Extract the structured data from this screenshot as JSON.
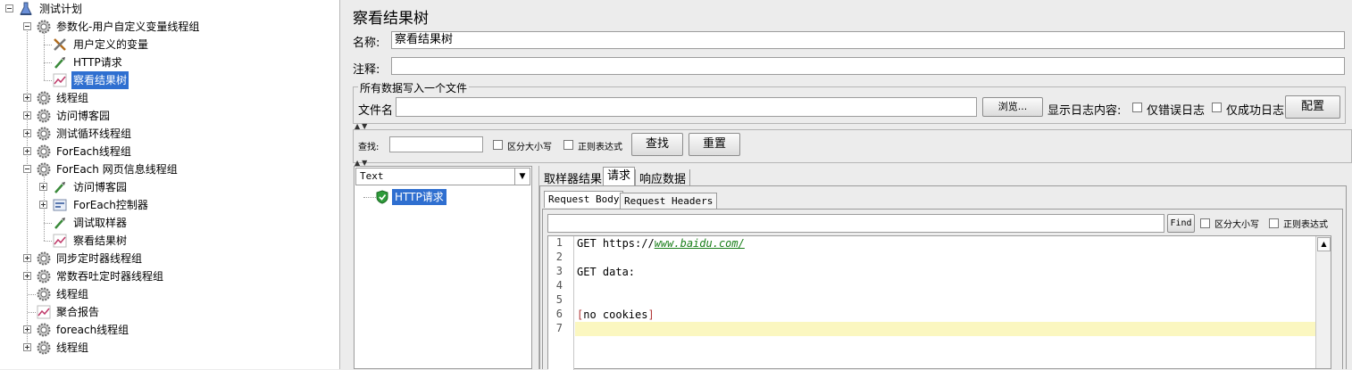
{
  "tree": {
    "items": [
      {
        "label": "测试计划",
        "icon": "test-plan-icon",
        "level": 0,
        "expander": "minus"
      },
      {
        "label": "参数化-用户自定义变量线程组",
        "icon": "thread-group-gear-icon",
        "level": 1,
        "expander": "minus"
      },
      {
        "label": "用户定义的变量",
        "icon": "config-tools-icon",
        "level": 2,
        "expander": ""
      },
      {
        "label": "HTTP请求",
        "icon": "sampler-pipette-icon",
        "level": 2,
        "expander": ""
      },
      {
        "label": "察看结果树",
        "icon": "listener-graph-icon",
        "level": 2,
        "expander": "",
        "selected": true
      },
      {
        "label": "线程组",
        "icon": "thread-group-gear-icon",
        "level": 1,
        "expander": "plus"
      },
      {
        "label": "访问博客园",
        "icon": "thread-group-gear-icon",
        "level": 1,
        "expander": "plus"
      },
      {
        "label": "测试循环线程组",
        "icon": "thread-group-gear-icon",
        "level": 1,
        "expander": "plus"
      },
      {
        "label": "ForEach线程组",
        "icon": "thread-group-gear-icon",
        "level": 1,
        "expander": "plus"
      },
      {
        "label": "ForEach 网页信息线程组",
        "icon": "thread-group-gear-icon",
        "level": 1,
        "expander": "minus"
      },
      {
        "label": "访问博客园",
        "icon": "sampler-pipette-icon",
        "level": 2,
        "expander": "plus"
      },
      {
        "label": "ForEach控制器",
        "icon": "controller-icon",
        "level": 2,
        "expander": "plus"
      },
      {
        "label": "调试取样器",
        "icon": "sampler-pipette-icon",
        "level": 2,
        "expander": ""
      },
      {
        "label": "察看结果树",
        "icon": "listener-graph-icon",
        "level": 2,
        "expander": ""
      },
      {
        "label": "同步定时器线程组",
        "icon": "thread-group-gear-icon",
        "level": 1,
        "expander": "plus"
      },
      {
        "label": "常数吞吐定时器线程组",
        "icon": "thread-group-gear-icon",
        "level": 1,
        "expander": "plus"
      },
      {
        "label": "线程组",
        "icon": "thread-group-gear-icon",
        "level": 1,
        "expander": ""
      },
      {
        "label": "聚合报告",
        "icon": "listener-graph-icon",
        "level": 1,
        "expander": ""
      },
      {
        "label": "foreach线程组",
        "icon": "thread-group-gear-icon",
        "level": 1,
        "expander": "plus"
      },
      {
        "label": "线程组",
        "icon": "thread-group-gear-icon",
        "level": 1,
        "expander": "plus"
      }
    ]
  },
  "panel": {
    "title": "察看结果树",
    "name_label": "名称:",
    "name_value": "察看结果树",
    "comment_label": "注释:",
    "comment_value": "",
    "file_group_title": "所有数据写入一个文件",
    "filename_label": "文件名",
    "filename_value": "",
    "browse_button": "浏览...",
    "log_content_label": "显示日志内容:",
    "errors_only_label": "仅错误日志",
    "success_only_label": "仅成功日志",
    "configure_button": "配置"
  },
  "search": {
    "label": "查找:",
    "value": "",
    "case_sensitive_label": "区分大小写",
    "regex_label": "正则表达式",
    "find_button": "查找",
    "reset_button": "重置"
  },
  "results": {
    "renderer_selected": "Text",
    "tree_items": [
      {
        "label": "HTTP请求",
        "status": "success"
      }
    ]
  },
  "detail": {
    "tabs": [
      "取样器结果",
      "请求",
      "响应数据"
    ],
    "active_tab": "请求",
    "subtabs": [
      "Request Body",
      "Request Headers"
    ],
    "active_subtab": "Request Body",
    "find_button": "Find",
    "case_sensitive_label": "区分大小写",
    "regex_label": "正则表达式",
    "line_numbers": [
      "1",
      "2",
      "3",
      "4",
      "5",
      "6",
      "7"
    ],
    "code": {
      "line1_prefix": "GET https://",
      "line1_link": "www.baidu.com/",
      "line3": "GET data:",
      "line6_open": "[",
      "line6_text": "no cookies",
      "line6_close": "]"
    }
  },
  "colors": {
    "selection": "#2f6fd0",
    "link": "#1a7f1a",
    "bracket": "#b23a3a",
    "current_line": "#fbf7c0",
    "success": "#2e9b3a"
  }
}
